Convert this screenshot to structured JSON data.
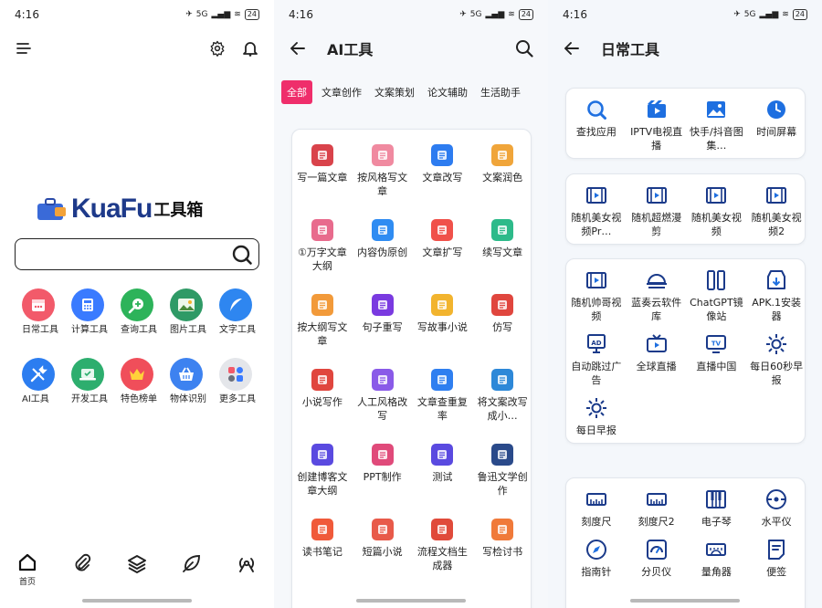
{
  "status": {
    "time": "4:16",
    "net": "5G",
    "battery": "24"
  },
  "home": {
    "logo_text": "KuaFu",
    "logo_suffix": "工具箱",
    "tools_row1": [
      {
        "label": "日常工具",
        "icon": "calendar-icon",
        "color": "#f25a6a"
      },
      {
        "label": "计算工具",
        "icon": "calculator-icon",
        "color": "#3a7bff"
      },
      {
        "label": "查询工具",
        "icon": "search-plus-icon",
        "color": "#2db35a"
      },
      {
        "label": "图片工具",
        "icon": "image-icon",
        "color": "#2f9a66"
      },
      {
        "label": "文字工具",
        "icon": "feather-icon",
        "color": "#2e86f0"
      }
    ],
    "tools_row2": [
      {
        "label": "AI工具",
        "icon": "wrench-icon",
        "color": "#2c7df0"
      },
      {
        "label": "开发工具",
        "icon": "laptop-icon",
        "color": "#2dae6e"
      },
      {
        "label": "特色榜单",
        "icon": "crown-icon",
        "color": "#f04e5a"
      },
      {
        "label": "物体识别",
        "icon": "basket-icon",
        "color": "#3d82f0"
      },
      {
        "label": "更多工具",
        "icon": "apps-icon",
        "color": "#e4e6ea"
      }
    ],
    "nav": [
      {
        "label": "首页",
        "icon": "home-icon"
      },
      {
        "label": "",
        "icon": "paperclip-icon"
      },
      {
        "label": "",
        "icon": "layers-icon"
      },
      {
        "label": "",
        "icon": "leaf-icon"
      },
      {
        "label": "",
        "icon": "signal-icon"
      }
    ]
  },
  "ai": {
    "title": "AI工具",
    "tabs": [
      "全部",
      "文章创作",
      "文案策划",
      "论文辅助",
      "生活助手"
    ],
    "items": [
      {
        "label": "写一篇文章",
        "color": "#d9434b"
      },
      {
        "label": "按风格写文章",
        "color": "#f08aa0"
      },
      {
        "label": "文章改写",
        "color": "#2d7cf0"
      },
      {
        "label": "文案润色",
        "color": "#f0a53a"
      },
      {
        "label": "①万字文章大纲",
        "color": "#e86b8d"
      },
      {
        "label": "内容伪原创",
        "color": "#2f8cf2"
      },
      {
        "label": "文章扩写",
        "color": "#f0514a"
      },
      {
        "label": "续写文章",
        "color": "#2dba8a"
      },
      {
        "label": "按大纲写文章",
        "color": "#f29a3a"
      },
      {
        "label": "句子重写",
        "color": "#7a3ae0"
      },
      {
        "label": "写故事小说",
        "color": "#f2b42e"
      },
      {
        "label": "仿写",
        "color": "#e0463e"
      },
      {
        "label": "小说写作",
        "color": "#e0463e"
      },
      {
        "label": "人工风格改写",
        "color": "#8a5ae8"
      },
      {
        "label": "文章查重复率",
        "color": "#2f7ff0"
      },
      {
        "label": "将文案改写成小…",
        "color": "#2d88d8"
      },
      {
        "label": "创建博客文章大纲",
        "color": "#5a4ae0"
      },
      {
        "label": "PPT制作",
        "color": "#e04a7a"
      },
      {
        "label": "测试",
        "color": "#5a4ae0"
      },
      {
        "label": "鲁迅文学创作",
        "color": "#2a4a8a"
      },
      {
        "label": "读书笔记",
        "color": "#f05a3a"
      },
      {
        "label": "短篇小说",
        "color": "#e85a4a"
      },
      {
        "label": "流程文档生成器",
        "color": "#e04a3a"
      },
      {
        "label": "写检讨书",
        "color": "#f07a3a"
      }
    ]
  },
  "daily": {
    "title": "日常工具",
    "groups": [
      [
        {
          "label": "查找应用",
          "icon": "magnifier-icon"
        },
        {
          "label": "IPTV电视直播",
          "icon": "tv-clapper-icon"
        },
        {
          "label": "快手/抖音图集…",
          "icon": "photo-icon"
        },
        {
          "label": "时间屏幕",
          "icon": "clock-icon"
        }
      ],
      [
        {
          "label": "随机美女视频Pr…",
          "icon": "film-icon"
        },
        {
          "label": "随机超燃漫剪",
          "icon": "film-icon"
        },
        {
          "label": "随机美女视频",
          "icon": "film-icon"
        },
        {
          "label": "随机美女视频2",
          "icon": "film-icon"
        }
      ],
      [
        {
          "label": "随机帅哥视频",
          "icon": "film-icon"
        },
        {
          "label": "蓝奏云软件库",
          "icon": "cloud-icon"
        },
        {
          "label": "ChatGPT镜像站",
          "icon": "mirror-icon"
        },
        {
          "label": "APK.1安装器",
          "icon": "install-icon"
        },
        {
          "label": "自动跳过广告",
          "icon": "ad-icon"
        },
        {
          "label": "全球直播",
          "icon": "tv-play-icon"
        },
        {
          "label": "直播中国",
          "icon": "tv-icon"
        },
        {
          "label": "每日60秒早报",
          "icon": "sun-icon"
        },
        {
          "label": "每日早报",
          "icon": "sun-icon"
        }
      ],
      [
        {
          "label": "刻度尺",
          "icon": "ruler-icon"
        },
        {
          "label": "刻度尺2",
          "icon": "ruler-icon"
        },
        {
          "label": "电子琴",
          "icon": "piano-icon"
        },
        {
          "label": "水平仪",
          "icon": "level-icon"
        },
        {
          "label": "指南针",
          "icon": "compass-icon"
        },
        {
          "label": "分贝仪",
          "icon": "gauge-icon"
        },
        {
          "label": "量角器",
          "icon": "protractor-icon"
        },
        {
          "label": "便签",
          "icon": "note-icon"
        }
      ]
    ]
  }
}
